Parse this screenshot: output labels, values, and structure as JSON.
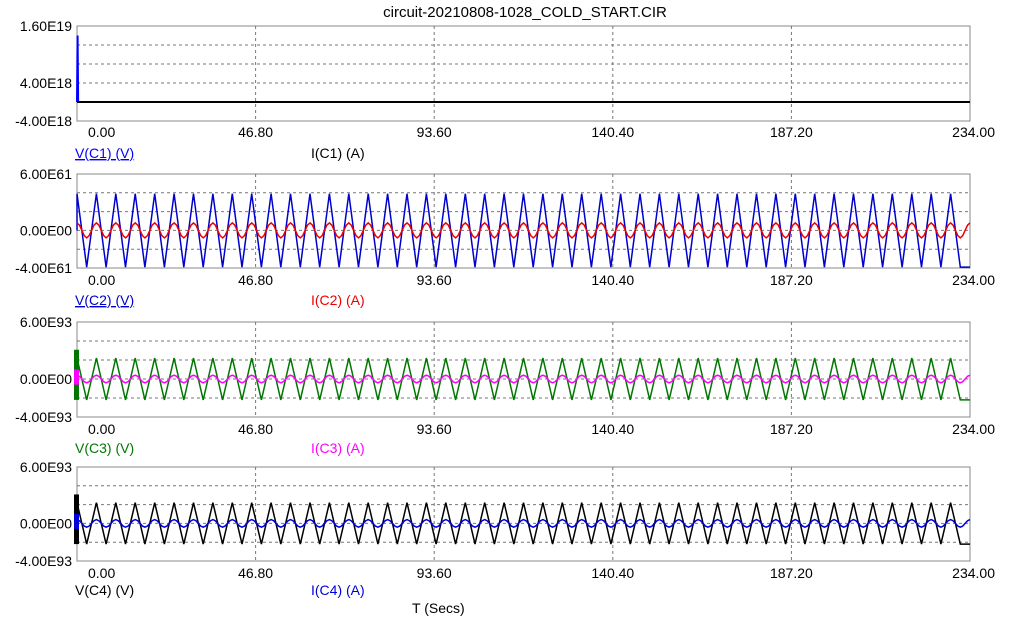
{
  "title": "circuit-20210808-1028_COLD_START.CIR",
  "x_axis_title": "T (Secs)",
  "chart_data": [
    {
      "type": "line",
      "y_ticks": [
        "1.60E19",
        "4.00E18",
        "-4.00E18"
      ],
      "ylim": [
        -4e+18,
        1.6e+19
      ],
      "x_ticks": [
        "0.00",
        "46.80",
        "93.60",
        "140.40",
        "187.20",
        "234.00"
      ],
      "xlim": [
        0,
        234
      ],
      "grid": true,
      "series": [
        {
          "name": "V(C1) (V)",
          "color": "#0000ff",
          "underline": true,
          "shape": "spike",
          "baseline": 0,
          "peak": 1.4e+19
        },
        {
          "name": "I(C1) (A)",
          "color": "#000000",
          "shape": "flat",
          "baseline": 0
        }
      ]
    },
    {
      "type": "line",
      "y_ticks": [
        "6.00E61",
        "0.00E00",
        "-4.00E61"
      ],
      "ylim": [
        -4e+61,
        6e+61
      ],
      "x_ticks": [
        "0.00",
        "46.80",
        "93.60",
        "140.40",
        "187.20",
        "234.00"
      ],
      "xlim": [
        0,
        234
      ],
      "grid": true,
      "series": [
        {
          "name": "V(C2) (V)",
          "color": "#0000cc",
          "underline": true,
          "shape": "triangle",
          "amplitude": 3.9e+61,
          "cycles": 46
        },
        {
          "name": "I(C2) (A)",
          "color": "#ee0000",
          "shape": "sine",
          "amplitude": 8e+60,
          "cycles": 46
        }
      ]
    },
    {
      "type": "line",
      "y_ticks": [
        "6.00E93",
        "0.00E00",
        "-4.00E93"
      ],
      "ylim": [
        -4e+93,
        6e+93
      ],
      "x_ticks": [
        "0.00",
        "46.80",
        "93.60",
        "140.40",
        "187.20",
        "234.00"
      ],
      "xlim": [
        0,
        234
      ],
      "grid": true,
      "series": [
        {
          "name": "V(C3) (V)",
          "color": "#007700",
          "shape": "triangle",
          "amplitude": 2.2e+93,
          "cycles": 46
        },
        {
          "name": "I(C3) (A)",
          "color": "#ff00ff",
          "shape": "sine",
          "amplitude": 4e+92,
          "cycles": 46
        }
      ]
    },
    {
      "type": "line",
      "y_ticks": [
        "6.00E93",
        "0.00E00",
        "-4.00E93"
      ],
      "ylim": [
        -4e+93,
        6e+93
      ],
      "x_ticks": [
        "0.00",
        "46.80",
        "93.60",
        "140.40",
        "187.20",
        "234.00"
      ],
      "xlim": [
        0,
        234
      ],
      "grid": true,
      "series": [
        {
          "name": "V(C4) (V)",
          "color": "#000000",
          "shape": "triangle",
          "amplitude": 2.2e+93,
          "cycles": 46
        },
        {
          "name": "I(C4) (A)",
          "color": "#0000dd",
          "shape": "sine",
          "amplitude": 4e+92,
          "cycles": 46
        }
      ]
    }
  ]
}
